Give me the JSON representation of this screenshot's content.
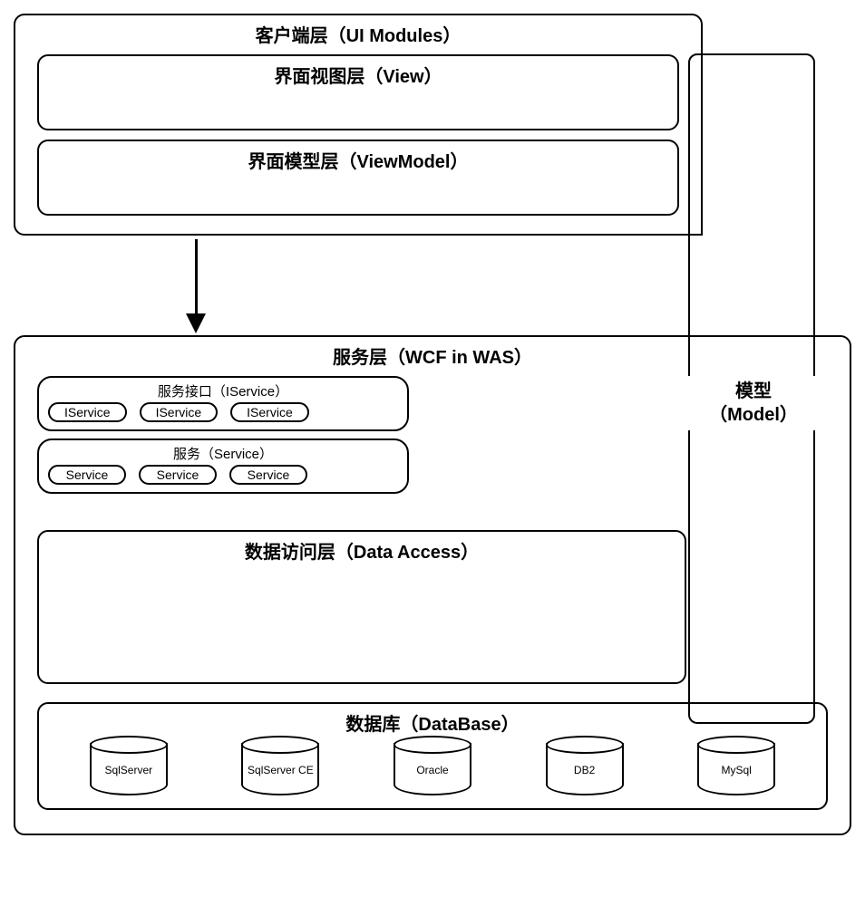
{
  "client": {
    "title": "客户端层（UI Modules）",
    "view_title": "界面视图层（View）",
    "viewmodel_title": "界面模型层（ViewModel）"
  },
  "service": {
    "title": "服务层（WCF in WAS）",
    "iservice_group_title": "服务接口（IService）",
    "iservice_items": [
      "IService",
      "IService",
      "IService"
    ],
    "service_group_title": "服务（Service）",
    "service_items": [
      "Service",
      "Service",
      "Service"
    ],
    "data_access_title": "数据访问层（Data Access）",
    "database_title": "数据库（DataBase）",
    "databases": [
      "SqlServer",
      "SqlServer CE",
      "Oracle",
      "DB2",
      "MySql"
    ]
  },
  "model": {
    "label_line1": "模型",
    "label_line2": "（Model）"
  }
}
